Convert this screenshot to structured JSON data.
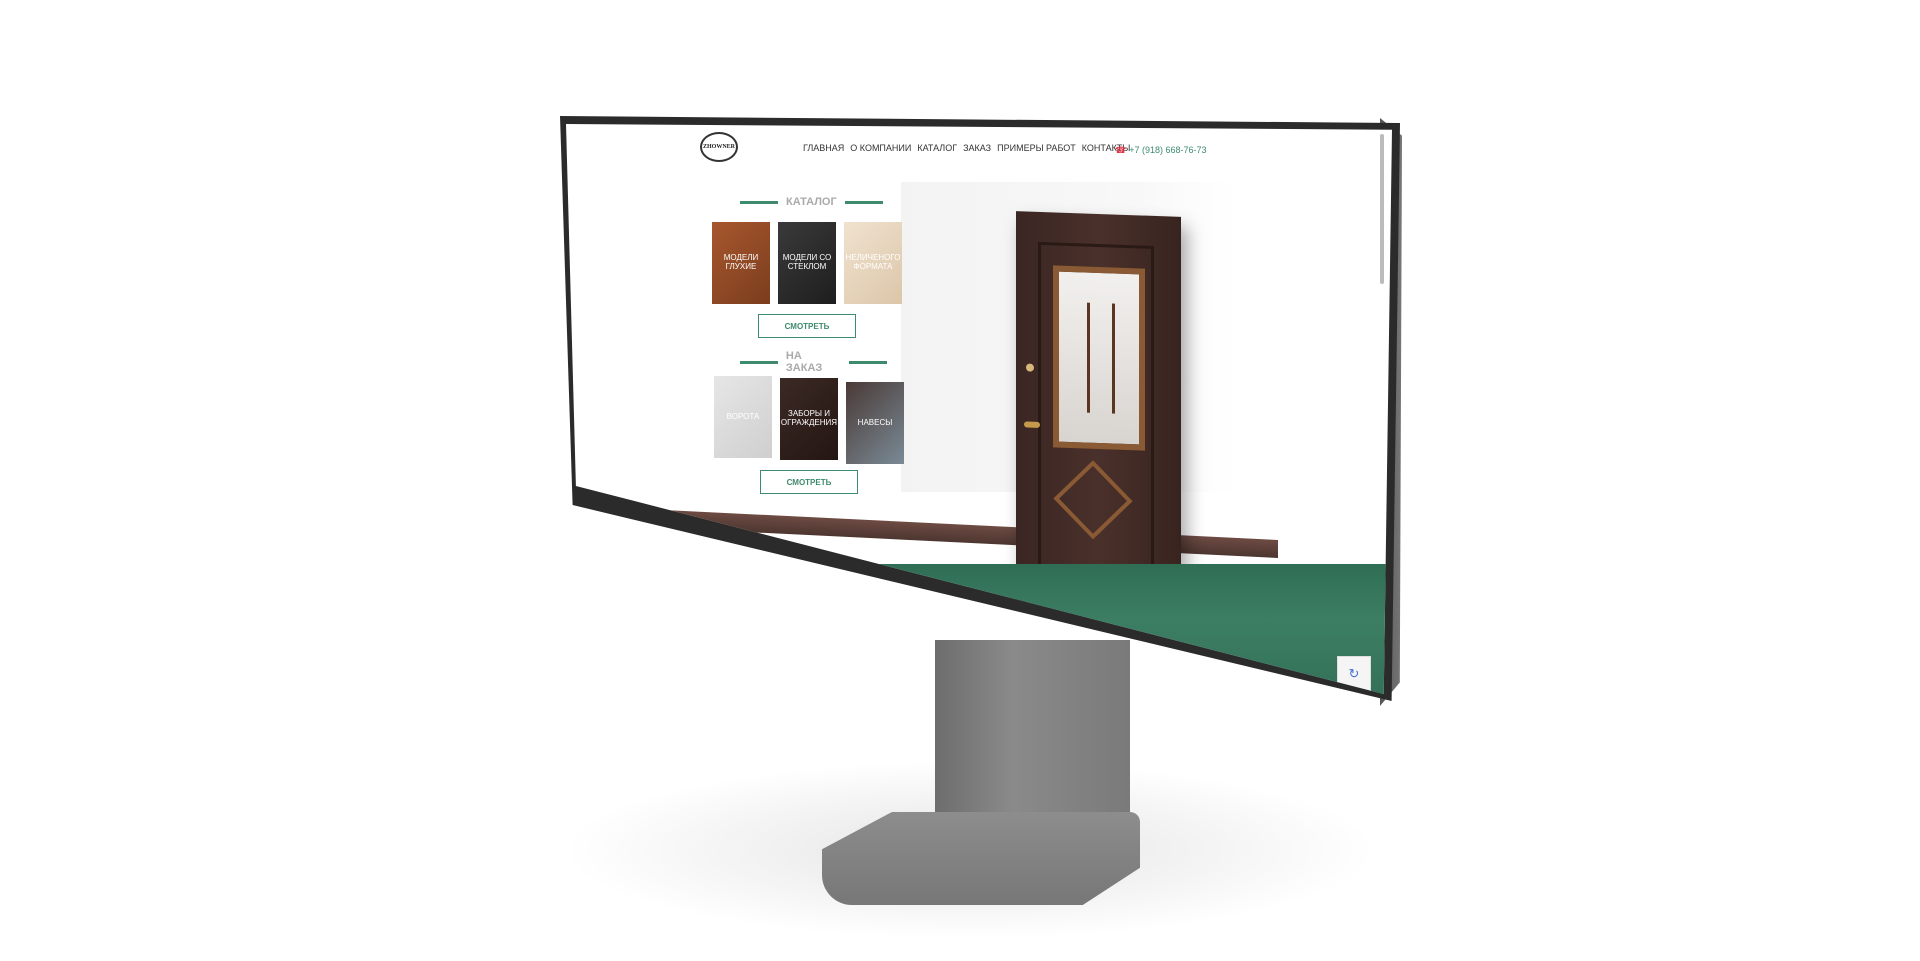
{
  "header": {
    "logo_text": "ZHOWNER",
    "nav": [
      "ГЛАВНАЯ",
      "О КОМПАНИИ",
      "КАТАЛОГ",
      "ЗАКАЗ",
      "ПРИМЕРЫ РАБОТ",
      "КОНТАКТЫ"
    ],
    "phone": "+7 (918) 668-76-73",
    "phone_icon": "phone-icon"
  },
  "catalog": {
    "title": "КАТАЛОГ",
    "tiles": [
      "МОДЕЛИ ГЛУХИЕ",
      "МОДЕЛИ СО СТЕКЛОМ",
      "НЕЛИЧЕНОГО ФОРМАТА"
    ],
    "button": "СМОТРЕТЬ"
  },
  "order": {
    "title": "НА ЗАКАЗ",
    "tiles": [
      "ВОРОТА",
      "ЗАБОРЫ И ОГРАЖДЕНИЯ",
      "НАВЕСЫ"
    ],
    "button": "СМОТРЕТЬ"
  },
  "colors": {
    "accent": "#3e8a6c",
    "band": "#357459",
    "door": "#3f2a25"
  }
}
